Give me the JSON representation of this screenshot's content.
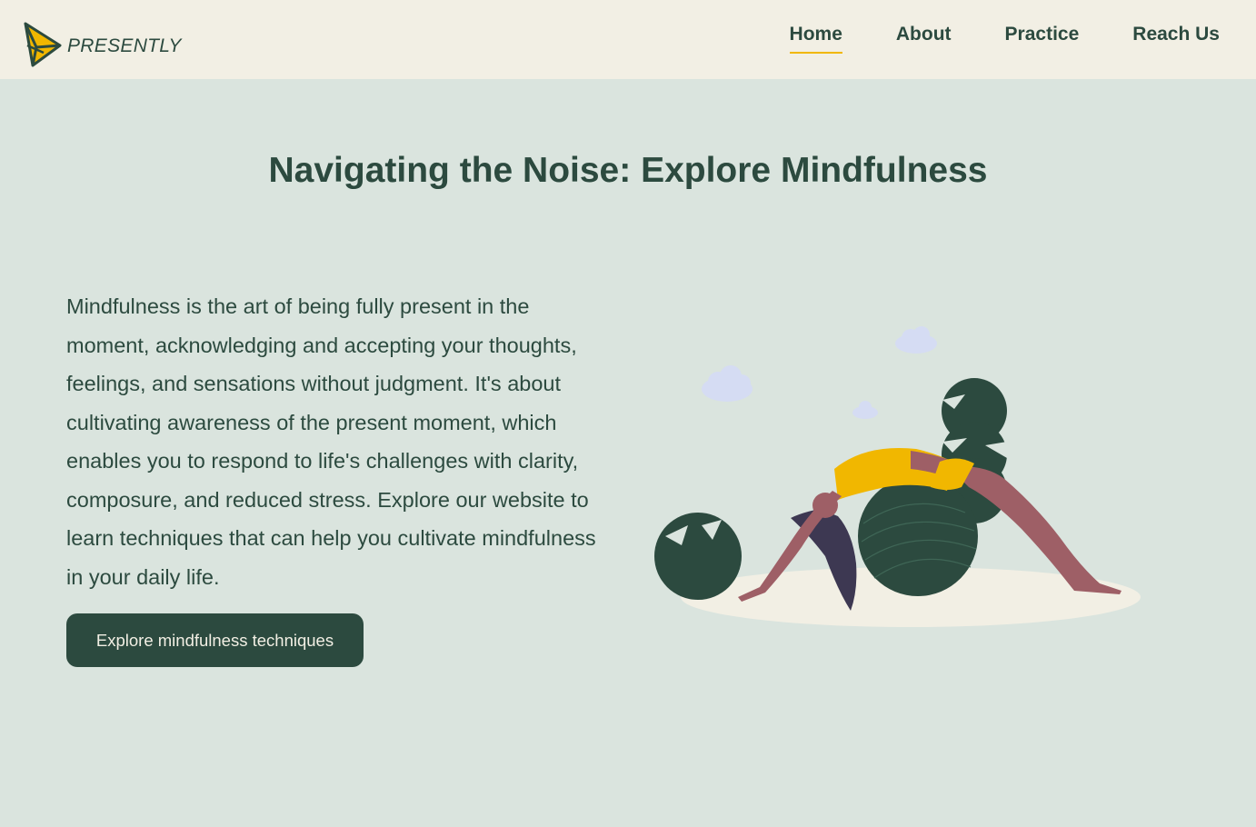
{
  "header": {
    "logo_text": "PRESENTLY",
    "nav": [
      {
        "label": "Home",
        "active": true
      },
      {
        "label": "About",
        "active": false
      },
      {
        "label": "Practice",
        "active": false
      },
      {
        "label": "Reach Us",
        "active": false
      }
    ]
  },
  "hero": {
    "title": "Navigating the Noise: Explore Mindfulness",
    "body": "Mindfulness is the art of being fully present in the moment, acknowledging and accepting your thoughts, feelings, and sensations without judgment. It's about cultivating awareness of the present moment, which enables you to respond to life's challenges with clarity, composure, and reduced stress. Explore our website to learn techniques that can help you cultivate mindfulness in your daily life.",
    "cta_label": "Explore mindfulness techniques"
  },
  "illustration": {
    "icon": "yoga-woman-illustration"
  },
  "colors": {
    "header_bg": "#f2efe4",
    "page_bg": "#dae4de",
    "brand_dark_green": "#2c4a3f",
    "accent_yellow": "#f1b700",
    "skin": "#9e5f66",
    "hair": "#3d3852",
    "cloud": "#d5dcf3"
  }
}
